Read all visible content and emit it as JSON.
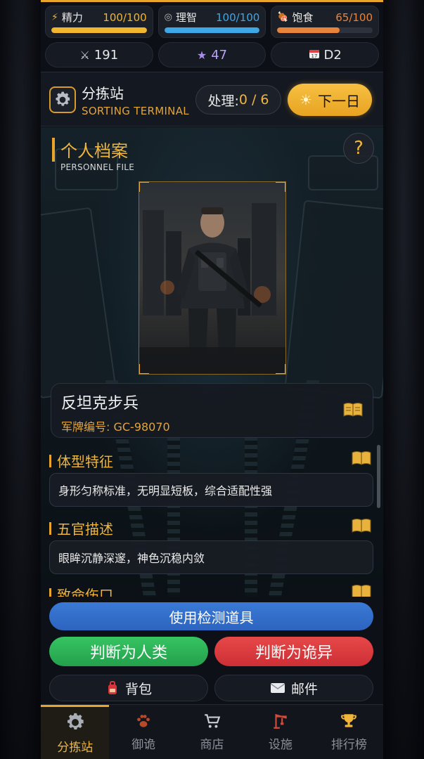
{
  "stats": [
    {
      "icon": "lightning-icon",
      "label": "精力",
      "value": "100/100",
      "fraction": 1.0,
      "color": "#f2b52e"
    },
    {
      "icon": "brain-icon",
      "label": "理智",
      "value": "100/100",
      "fraction": 1.0,
      "color": "#3ea7e6"
    },
    {
      "icon": "food-icon",
      "label": "饱食",
      "value": "65/100",
      "fraction": 0.65,
      "color": "#e8843a"
    }
  ],
  "info": {
    "kills": "191",
    "stars": "47",
    "day": "D2"
  },
  "header": {
    "title": "分拣站",
    "subtitle": "SORTING TERMINAL",
    "process_label": "处理:",
    "process_value": "0 / 6",
    "next_day_label": "下一日"
  },
  "profile": {
    "section_title": "个人档案",
    "section_sub": "PERSONNEL FILE",
    "help": "?",
    "name": "反坦克步兵",
    "tag_label": "军牌编号: GC-98070"
  },
  "sections": [
    {
      "title": "体型特征",
      "text": "身形匀称标准，无明显短板，综合适配性强"
    },
    {
      "title": "五官描述",
      "text": "眼眸沉静深邃，神色沉稳内敛"
    },
    {
      "title": "致命伤口",
      "text": ""
    }
  ],
  "actions": {
    "detect": "使用检测道具",
    "human": "判断为人类",
    "weird": "判断为诡异",
    "bag": "背包",
    "mail": "邮件"
  },
  "tabs": [
    {
      "label": "分拣站",
      "icon": "gear-icon",
      "active": true
    },
    {
      "label": "御诡",
      "icon": "paw-icon",
      "active": false
    },
    {
      "label": "商店",
      "icon": "cart-icon",
      "active": false
    },
    {
      "label": "设施",
      "icon": "crane-icon",
      "active": false
    },
    {
      "label": "排行榜",
      "icon": "trophy-icon",
      "active": false
    }
  ]
}
